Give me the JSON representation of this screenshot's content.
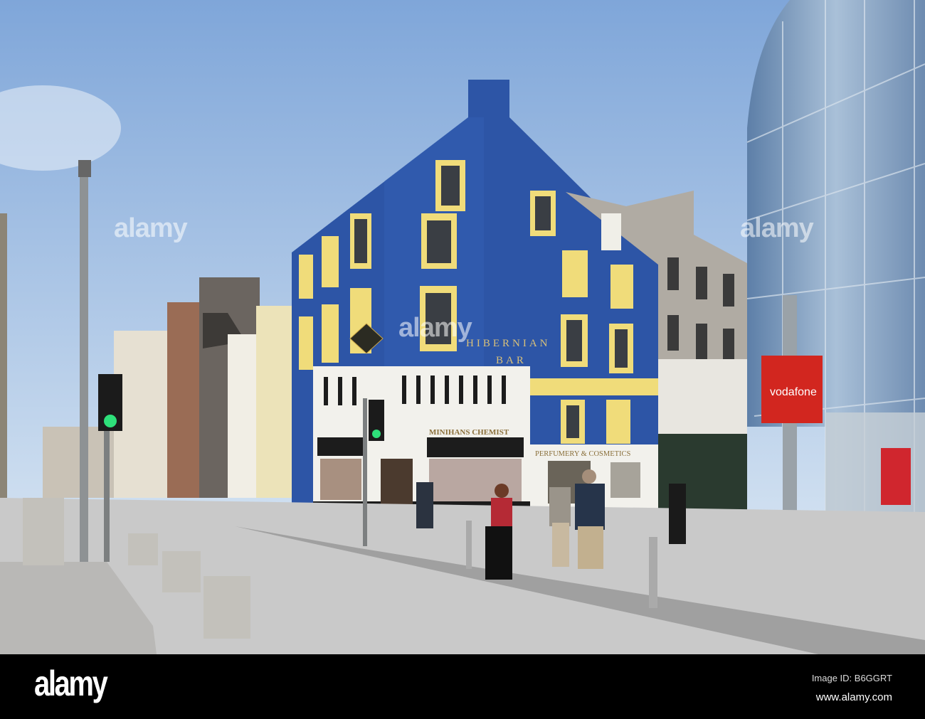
{
  "photo": {
    "signs": {
      "pub_name_line1": "HIBERNIAN",
      "pub_name_line2": "BAR",
      "chemist": "MINIHANS CHEMIST",
      "perfumery": "PERFUMERY & COSMETICS",
      "vodafone": "vodafone"
    },
    "colors": {
      "sky": "#a9c4e6",
      "pub_blue": "#2d55a6",
      "window_trim": "#f0dc7a",
      "pavement": "#c9c9c9",
      "vodafone_red": "#d2261f"
    }
  },
  "watermark": {
    "text": "alamy"
  },
  "footer": {
    "logo": "alamy",
    "image_id": "Image ID: B6GGRT",
    "url": "www.alamy.com"
  }
}
